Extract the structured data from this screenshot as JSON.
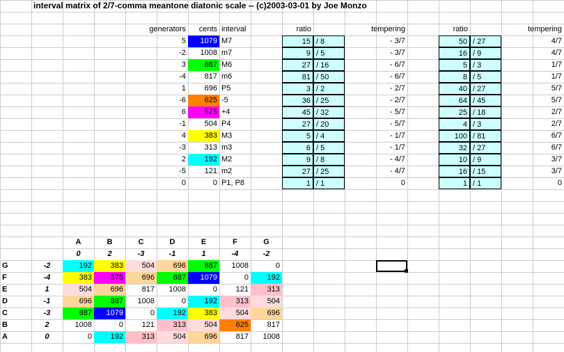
{
  "title": "interval matrix of 2/7-comma meantone diatonic scale -- (c)2003-03-01 by Joe Monzo",
  "colors": {
    "lightblue": "#cdffff",
    "yellow": "#ffff00",
    "magenta": "#ff00ff",
    "cyan": "#00ffff",
    "green": "#00ff00",
    "blue": "#0000ff",
    "orange": "#ff8000",
    "pink": "#ffc0cb",
    "peach": "#ffd699",
    "lightpink": "#ffdcdc"
  },
  "chart_data": {
    "intervals": {
      "headers": [
        "generators",
        "cents",
        "interval"
      ],
      "rows": [
        {
          "gen": 5,
          "cents": 1079,
          "interval": "M7",
          "color": "blue"
        },
        {
          "gen": -2,
          "cents": 1008,
          "interval": "m7",
          "color": null
        },
        {
          "gen": 3,
          "cents": 887,
          "interval": "M6",
          "color": "green"
        },
        {
          "gen": -4,
          "cents": 817,
          "interval": "m6",
          "color": null
        },
        {
          "gen": 1,
          "cents": 696,
          "interval": "P5",
          "color": null
        },
        {
          "gen": -6,
          "cents": 625,
          "interval": "-5",
          "color": "orange"
        },
        {
          "gen": 6,
          "cents": 575,
          "interval": "+4",
          "color": "magenta"
        },
        {
          "gen": -1,
          "cents": 504,
          "interval": "P4",
          "color": null
        },
        {
          "gen": 4,
          "cents": 383,
          "interval": "M3",
          "color": "yellow"
        },
        {
          "gen": -3,
          "cents": 313,
          "interval": "m3",
          "color": null
        },
        {
          "gen": 2,
          "cents": 192,
          "interval": "M2",
          "color": "cyan"
        },
        {
          "gen": -5,
          "cents": 121,
          "interval": "m2",
          "color": null
        },
        {
          "gen": 0,
          "cents": 0,
          "interval": "P1, P8",
          "color": null
        }
      ]
    },
    "ratios1": {
      "headers": [
        "ratio",
        "tempering"
      ],
      "rows": [
        {
          "num": 15,
          "slash": "/",
          "den": 8,
          "temp": "- 3/7"
        },
        {
          "num": 9,
          "slash": "/",
          "den": 5,
          "temp": "- 3/7"
        },
        {
          "num": 27,
          "slash": "/",
          "den": 16,
          "temp": "- 6/7"
        },
        {
          "num": 81,
          "slash": "/",
          "den": 50,
          "temp": "- 6/7"
        },
        {
          "num": 3,
          "slash": "/",
          "den": 2,
          "temp": "- 2/7"
        },
        {
          "num": 36,
          "slash": "/",
          "den": 25,
          "temp": "- 2/7"
        },
        {
          "num": 45,
          "slash": "/",
          "den": 32,
          "temp": "- 5/7"
        },
        {
          "num": 27,
          "slash": "/",
          "den": 20,
          "temp": "- 5/7"
        },
        {
          "num": 5,
          "slash": "/",
          "den": 4,
          "temp": "- 1/7"
        },
        {
          "num": 6,
          "slash": "/",
          "den": 5,
          "temp": "- 1/7"
        },
        {
          "num": 9,
          "slash": "/",
          "den": 8,
          "temp": "- 4/7"
        },
        {
          "num": 27,
          "slash": "/",
          "den": 25,
          "temp": "- 4/7"
        },
        {
          "num": 1,
          "slash": "/",
          "den": 1,
          "temp": "0"
        }
      ]
    },
    "ratios2": {
      "headers": [
        "ratio",
        "tempering"
      ],
      "rows": [
        {
          "num": 50,
          "slash": "/",
          "den": 27,
          "temp": "4/7"
        },
        {
          "num": 16,
          "slash": "/",
          "den": 9,
          "temp": "4/7"
        },
        {
          "num": 5,
          "slash": "/",
          "den": 3,
          "temp": "1/7"
        },
        {
          "num": 8,
          "slash": "/",
          "den": 5,
          "temp": "1/7"
        },
        {
          "num": 40,
          "slash": "/",
          "den": 27,
          "temp": "5/7"
        },
        {
          "num": 64,
          "slash": "/",
          "den": 45,
          "temp": "5/7"
        },
        {
          "num": 25,
          "slash": "/",
          "den": 18,
          "temp": "2/7"
        },
        {
          "num": 4,
          "slash": "/",
          "den": 3,
          "temp": "2/7"
        },
        {
          "num": 100,
          "slash": "/",
          "den": 81,
          "temp": "6/7"
        },
        {
          "num": 32,
          "slash": "/",
          "den": 27,
          "temp": "6/7"
        },
        {
          "num": 10,
          "slash": "/",
          "den": 9,
          "temp": "3/7"
        },
        {
          "num": 16,
          "slash": "/",
          "den": 15,
          "temp": "3/7"
        },
        {
          "num": 1,
          "slash": "/",
          "den": 1,
          "temp": "0"
        }
      ]
    },
    "matrix": {
      "col_labels": [
        "A",
        "B",
        "C",
        "D",
        "E",
        "F",
        "G"
      ],
      "col_nums": [
        0,
        2,
        -3,
        -1,
        1,
        -4,
        -2
      ],
      "row_labels": [
        "G",
        "F",
        "E",
        "D",
        "C",
        "B",
        "A"
      ],
      "row_nums": [
        -2,
        -4,
        1,
        -1,
        -3,
        2,
        0
      ],
      "cells": [
        [
          {
            "v": 192,
            "c": "cyan"
          },
          {
            "v": 383,
            "c": "yellow"
          },
          {
            "v": 504,
            "c": "lightpink"
          },
          {
            "v": 696,
            "c": "peach"
          },
          {
            "v": 887,
            "c": "green"
          },
          {
            "v": 1008,
            "c": null
          },
          {
            "v": 0,
            "c": null
          }
        ],
        [
          {
            "v": 383,
            "c": "yellow"
          },
          {
            "v": 575,
            "c": "magenta"
          },
          {
            "v": 696,
            "c": "peach"
          },
          {
            "v": 887,
            "c": "green"
          },
          {
            "v": 1079,
            "c": "blue"
          },
          {
            "v": 0,
            "c": null
          },
          {
            "v": 192,
            "c": "cyan"
          }
        ],
        [
          {
            "v": 504,
            "c": "lightpink"
          },
          {
            "v": 696,
            "c": "peach"
          },
          {
            "v": 817,
            "c": null
          },
          {
            "v": 1008,
            "c": null
          },
          {
            "v": 0,
            "c": null
          },
          {
            "v": 121,
            "c": null
          },
          {
            "v": 313,
            "c": "pink"
          }
        ],
        [
          {
            "v": 696,
            "c": "peach"
          },
          {
            "v": 887,
            "c": "green"
          },
          {
            "v": 1008,
            "c": null
          },
          {
            "v": 0,
            "c": null
          },
          {
            "v": 192,
            "c": "cyan"
          },
          {
            "v": 313,
            "c": "pink"
          },
          {
            "v": 504,
            "c": "lightpink"
          }
        ],
        [
          {
            "v": 887,
            "c": "green"
          },
          {
            "v": 1079,
            "c": "blue"
          },
          {
            "v": 0,
            "c": null
          },
          {
            "v": 192,
            "c": "cyan"
          },
          {
            "v": 383,
            "c": "yellow"
          },
          {
            "v": 504,
            "c": "lightpink"
          },
          {
            "v": 696,
            "c": "peach"
          }
        ],
        [
          {
            "v": 1008,
            "c": null
          },
          {
            "v": 0,
            "c": null
          },
          {
            "v": 121,
            "c": null
          },
          {
            "v": 313,
            "c": "pink"
          },
          {
            "v": 504,
            "c": "lightpink"
          },
          {
            "v": 625,
            "c": "orange"
          },
          {
            "v": 817,
            "c": null
          }
        ],
        [
          {
            "v": 0,
            "c": null
          },
          {
            "v": 192,
            "c": "cyan"
          },
          {
            "v": 313,
            "c": "pink"
          },
          {
            "v": 504,
            "c": "lightpink"
          },
          {
            "v": 696,
            "c": "peach"
          },
          {
            "v": 817,
            "c": null
          },
          {
            "v": 1008,
            "c": null
          }
        ]
      ]
    }
  }
}
